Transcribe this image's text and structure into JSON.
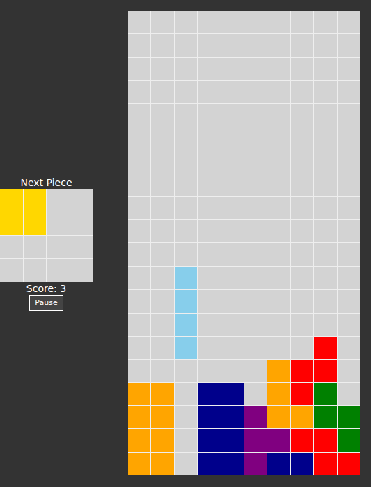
{
  "sidebar": {
    "next_label": "Next Piece",
    "next_piece": [
      [
        "Y",
        "Y",
        ".",
        "."
      ],
      [
        "Y",
        "Y",
        ".",
        "."
      ],
      [
        ".",
        ".",
        ".",
        "."
      ],
      [
        ".",
        ".",
        ".",
        "."
      ]
    ],
    "score": "Score: 3",
    "pause_button": "Pause"
  },
  "palette": {
    "O": "#ffa500",
    "R": "#ff0000",
    "G": "#008000",
    "N": "#00008b",
    "P": "#800080",
    "C": "#87ceeb",
    "Y": "#ffd700",
    ".": "#d3d3d3"
  },
  "board": {
    "rows": [
      [
        ".",
        ".",
        ".",
        ".",
        ".",
        ".",
        ".",
        ".",
        ".",
        "."
      ],
      [
        ".",
        ".",
        ".",
        ".",
        ".",
        ".",
        ".",
        ".",
        ".",
        "."
      ],
      [
        ".",
        ".",
        ".",
        ".",
        ".",
        ".",
        ".",
        ".",
        ".",
        "."
      ],
      [
        ".",
        ".",
        ".",
        ".",
        ".",
        ".",
        ".",
        ".",
        ".",
        "."
      ],
      [
        ".",
        ".",
        ".",
        ".",
        ".",
        ".",
        ".",
        ".",
        ".",
        "."
      ],
      [
        ".",
        ".",
        ".",
        ".",
        ".",
        ".",
        ".",
        ".",
        ".",
        "."
      ],
      [
        ".",
        ".",
        ".",
        ".",
        ".",
        ".",
        ".",
        ".",
        ".",
        "."
      ],
      [
        ".",
        ".",
        ".",
        ".",
        ".",
        ".",
        ".",
        ".",
        ".",
        "."
      ],
      [
        ".",
        ".",
        ".",
        ".",
        ".",
        ".",
        ".",
        ".",
        ".",
        "."
      ],
      [
        ".",
        ".",
        ".",
        ".",
        ".",
        ".",
        ".",
        ".",
        ".",
        "."
      ],
      [
        ".",
        ".",
        ".",
        ".",
        ".",
        ".",
        ".",
        ".",
        ".",
        "."
      ],
      [
        ".",
        ".",
        "C",
        ".",
        ".",
        ".",
        ".",
        ".",
        ".",
        "."
      ],
      [
        ".",
        ".",
        "C",
        ".",
        ".",
        ".",
        ".",
        ".",
        ".",
        "."
      ],
      [
        ".",
        ".",
        "C",
        ".",
        ".",
        ".",
        ".",
        ".",
        ".",
        "."
      ],
      [
        ".",
        ".",
        "C",
        ".",
        ".",
        ".",
        ".",
        ".",
        "R",
        "."
      ],
      [
        ".",
        ".",
        ".",
        ".",
        ".",
        ".",
        "O",
        "R",
        "R",
        "."
      ],
      [
        "O",
        "O",
        ".",
        "N",
        "N",
        ".",
        "O",
        "R",
        "G",
        "."
      ],
      [
        "O",
        "O",
        ".",
        "N",
        "N",
        "P",
        "O",
        "O",
        "G",
        "G"
      ],
      [
        "O",
        "O",
        ".",
        "N",
        "N",
        "P",
        "P",
        "R",
        "R",
        "G"
      ],
      [
        "O",
        "O",
        ".",
        "N",
        "N",
        "P",
        "N",
        "N",
        "R",
        "R"
      ]
    ]
  }
}
